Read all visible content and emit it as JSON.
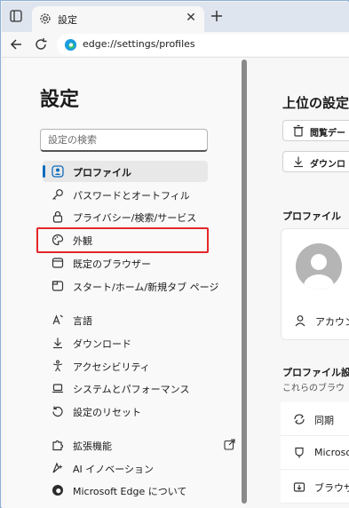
{
  "browser": {
    "tab_title": "設定",
    "close_glyph": "✕",
    "new_tab_glyph": "+",
    "url": "edge://settings/profiles"
  },
  "sidebar": {
    "title": "設定",
    "search_placeholder": "設定の検索",
    "items": [
      {
        "label": "プロファイル",
        "icon": "profile-icon",
        "selected": true
      },
      {
        "label": "パスワードとオートフィル",
        "icon": "key-icon"
      },
      {
        "label": "プライバシー/検索/サービス",
        "icon": "lock-icon"
      },
      {
        "label": "外観",
        "icon": "palette-icon"
      },
      {
        "label": "既定のブラウザー",
        "icon": "browser-window-icon"
      },
      {
        "label": "スタート/ホーム/新規タブ ページ",
        "icon": "home-tab-icon"
      },
      {
        "label": "言語",
        "icon": "language-icon"
      },
      {
        "label": "ダウンロード",
        "icon": "download-icon"
      },
      {
        "label": "アクセシビリティ",
        "icon": "accessibility-icon"
      },
      {
        "label": "システムとパフォーマンス",
        "icon": "laptop-icon"
      },
      {
        "label": "設定のリセット",
        "icon": "reset-icon"
      },
      {
        "label": "拡張機能",
        "icon": "puzzle-icon"
      },
      {
        "label": "AI イノベーション",
        "icon": "ai-sparkle-icon"
      },
      {
        "label": "Microsoft Edge について",
        "icon": "edge-logo-icon"
      }
    ]
  },
  "main": {
    "heading": "上位の設定",
    "buttons": [
      {
        "label": "閲覧デー",
        "icon": "trash-icon"
      },
      {
        "label": "ダウンロ",
        "icon": "download-icon"
      }
    ],
    "profile_section_title": "プロファイル",
    "account_label": "アカウン",
    "profile_settings_title": "プロファイル設",
    "profile_settings_sub": "これらのブラウ",
    "rows": [
      {
        "label": "同期",
        "icon": "sync-icon"
      },
      {
        "label": "Microso",
        "icon": "rewards-icon"
      },
      {
        "label": "ブラウザ",
        "icon": "import-icon"
      }
    ]
  },
  "colors": {
    "accent": "#0f6cbd",
    "highlight": "#e3272a"
  }
}
